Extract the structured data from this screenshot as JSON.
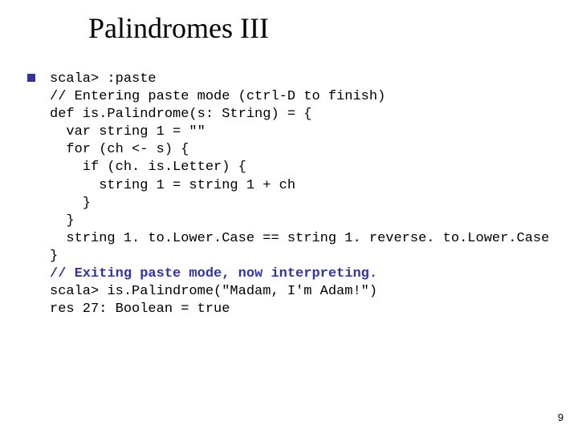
{
  "title": "Palindromes III",
  "code": {
    "l1": "scala> :paste",
    "l2": "// Entering paste mode (ctrl-D to finish)",
    "l3": "",
    "l4": "def is.Palindrome(s: String) = {",
    "l5": "  var string 1 = \"\"",
    "l6": "  for (ch <- s) {",
    "l7": "    if (ch. is.Letter) {",
    "l8": "      string 1 = string 1 + ch",
    "l9": "    }",
    "l10": "  }",
    "l11": "  string 1. to.Lower.Case == string 1. reverse. to.Lower.Case",
    "l12": "}",
    "l13": "",
    "l14": "// Exiting paste mode, now interpreting.",
    "l15": "",
    "l16": "scala> is.Palindrome(\"Madam, I'm Adam!\")",
    "l17": "res 27: Boolean = true"
  },
  "page_number": "9"
}
